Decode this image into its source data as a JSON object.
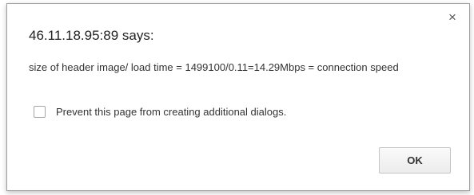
{
  "dialog": {
    "title": "46.11.18.95:89 says:",
    "message": "size of header image/ load time = 1499100/0.11=14.29Mbps = connection speed",
    "checkbox_label": "Prevent this page from creating additional dialogs.",
    "checkbox_checked": false,
    "ok_label": "OK",
    "close_icon": "close-icon"
  }
}
